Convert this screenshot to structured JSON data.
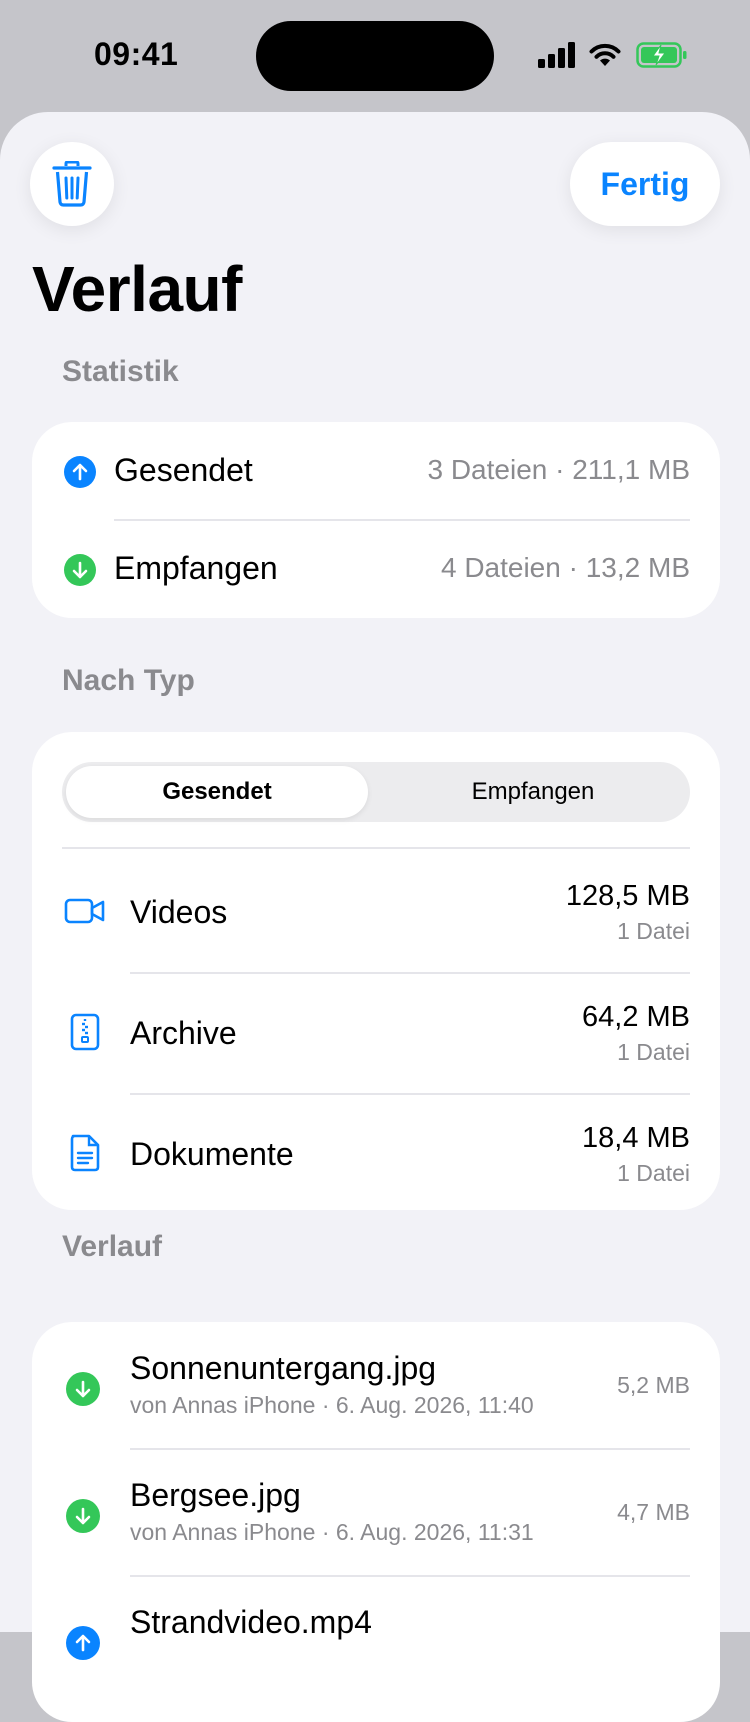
{
  "status_bar": {
    "time": "09:41"
  },
  "header": {
    "done_label": "Fertig",
    "title": "Verlauf"
  },
  "stats": {
    "header": "Statistik",
    "rows": [
      {
        "label": "Gesendet",
        "value": "3 Dateien · 211,1 MB",
        "color": "#0a84ff",
        "icon": "arrow-up-icon"
      },
      {
        "label": "Empfangen",
        "value": "4 Dateien · 13,2 MB",
        "color": "#34c759",
        "icon": "arrow-down-icon"
      }
    ]
  },
  "by_type": {
    "header": "Nach Typ",
    "segments": [
      "Gesendet",
      "Empfangen"
    ],
    "selected": "Gesendet",
    "rows": [
      {
        "label": "Videos",
        "size": "128,5 MB",
        "count": "1 Datei",
        "icon": "video-icon"
      },
      {
        "label": "Archive",
        "size": "64,2 MB",
        "count": "1 Datei",
        "icon": "archive-icon"
      },
      {
        "label": "Dokumente",
        "size": "18,4 MB",
        "count": "1 Datei",
        "icon": "document-icon"
      }
    ]
  },
  "history": {
    "header": "Verlauf",
    "items": [
      {
        "name": "Sonnenuntergang.jpg",
        "meta": "von Annas iPhone · 6. Aug. 2026, 11:40",
        "size": "5,2 MB",
        "direction": "received"
      },
      {
        "name": "Bergsee.jpg",
        "meta": "von Annas iPhone · 6. Aug. 2026, 11:31",
        "size": "4,7 MB",
        "direction": "received"
      },
      {
        "name": "Strandvideo.mp4",
        "direction": "sent"
      }
    ]
  },
  "colors": {
    "accent": "#0a84ff",
    "received": "#34c759",
    "secondary": "#8a8a8e"
  }
}
